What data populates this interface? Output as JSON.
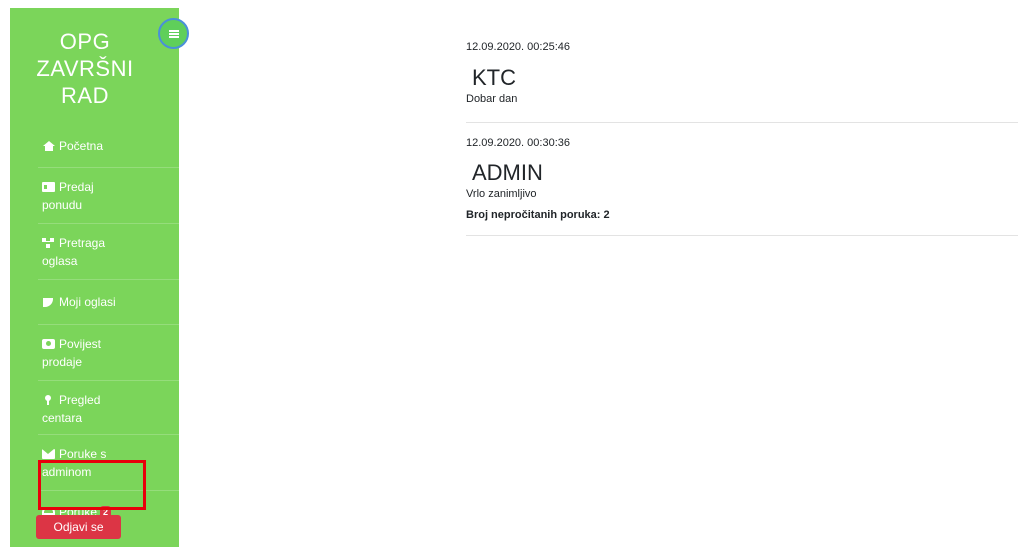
{
  "brand": {
    "line1": "OPG",
    "line2": "ZAVRŠNI",
    "line3": "RAD"
  },
  "sidebar": {
    "toggle_icon": "hamburger-icon",
    "items": [
      {
        "icon": "home-icon",
        "line1": "Početna",
        "line2": ""
      },
      {
        "icon": "id-card-icon",
        "line1": "Predaj",
        "line2": "ponudu"
      },
      {
        "icon": "sitemap-icon",
        "line1": "Pretraga",
        "line2": "oglasa"
      },
      {
        "icon": "satellite-dish-icon",
        "line1": "Moji oglasi",
        "line2": ""
      },
      {
        "icon": "address-card-icon",
        "line1": "Povijest",
        "line2": "prodaje"
      },
      {
        "icon": "map-pin-icon",
        "line1": "Pregled",
        "line2": "centara"
      },
      {
        "icon": "envelope-icon",
        "line1": "Poruke s",
        "line2": "adminom"
      },
      {
        "icon": "inbox-icon",
        "line1": "Poruke",
        "line2": "",
        "badge": "2"
      }
    ],
    "logout_label": "Odjavi se"
  },
  "messages": [
    {
      "timestamp": "12.09.2020. 00:25:46",
      "sender": "KTC",
      "text": "Dobar dan"
    },
    {
      "timestamp": "12.09.2020. 00:30:36",
      "sender": "ADMIN",
      "text": "Vrlo zanimljivo"
    }
  ],
  "unread_count_label": "Broj nepročitanih poruka: 2",
  "colors": {
    "sidebar": "#7bd55a",
    "danger": "#dc3545",
    "highlight": "#e8000b",
    "toggle_border": "#4a90d9"
  }
}
